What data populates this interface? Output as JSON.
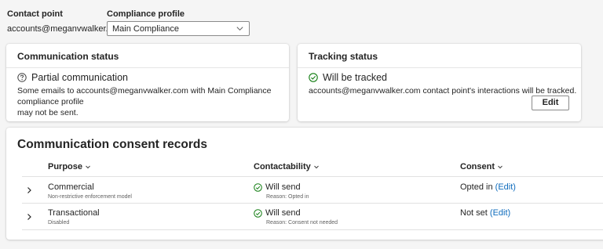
{
  "header": {
    "contact_point_label": "Contact point",
    "contact_point_value": "accounts@meganvwalker.com",
    "compliance_profile_label": "Compliance profile",
    "compliance_profile_value": "Main Compliance"
  },
  "communication_status": {
    "title": "Communication status",
    "status": "Partial communication",
    "description_line1": "Some emails to accounts@meganvwalker.com with Main Compliance compliance profile",
    "description_line2": "may not be sent."
  },
  "tracking_status": {
    "title": "Tracking status",
    "status": "Will be tracked",
    "description": "accounts@meganvwalker.com contact point's interactions will be tracked.",
    "edit_label": "Edit"
  },
  "consent_records": {
    "title": "Communication consent records",
    "columns": {
      "purpose": "Purpose",
      "contactability": "Contactability",
      "consent": "Consent"
    },
    "rows": [
      {
        "purpose": "Commercial",
        "purpose_sub": "Non-restrictive enforcement model",
        "contactability": "Will send",
        "reason": "Reason: Opted in",
        "consent": "Opted in",
        "edit": "(Edit)"
      },
      {
        "purpose": "Transactional",
        "purpose_sub": "Disabled",
        "contactability": "Will send",
        "reason": "Reason: Consent not needed",
        "consent": "Not set",
        "edit": "(Edit)"
      }
    ]
  },
  "colors": {
    "success": "#107c10",
    "link": "#0f6cbd"
  },
  "icons": [
    "chevron-down-icon",
    "question-circle-icon",
    "checkmark-circle-icon",
    "chevron-right-icon"
  ]
}
